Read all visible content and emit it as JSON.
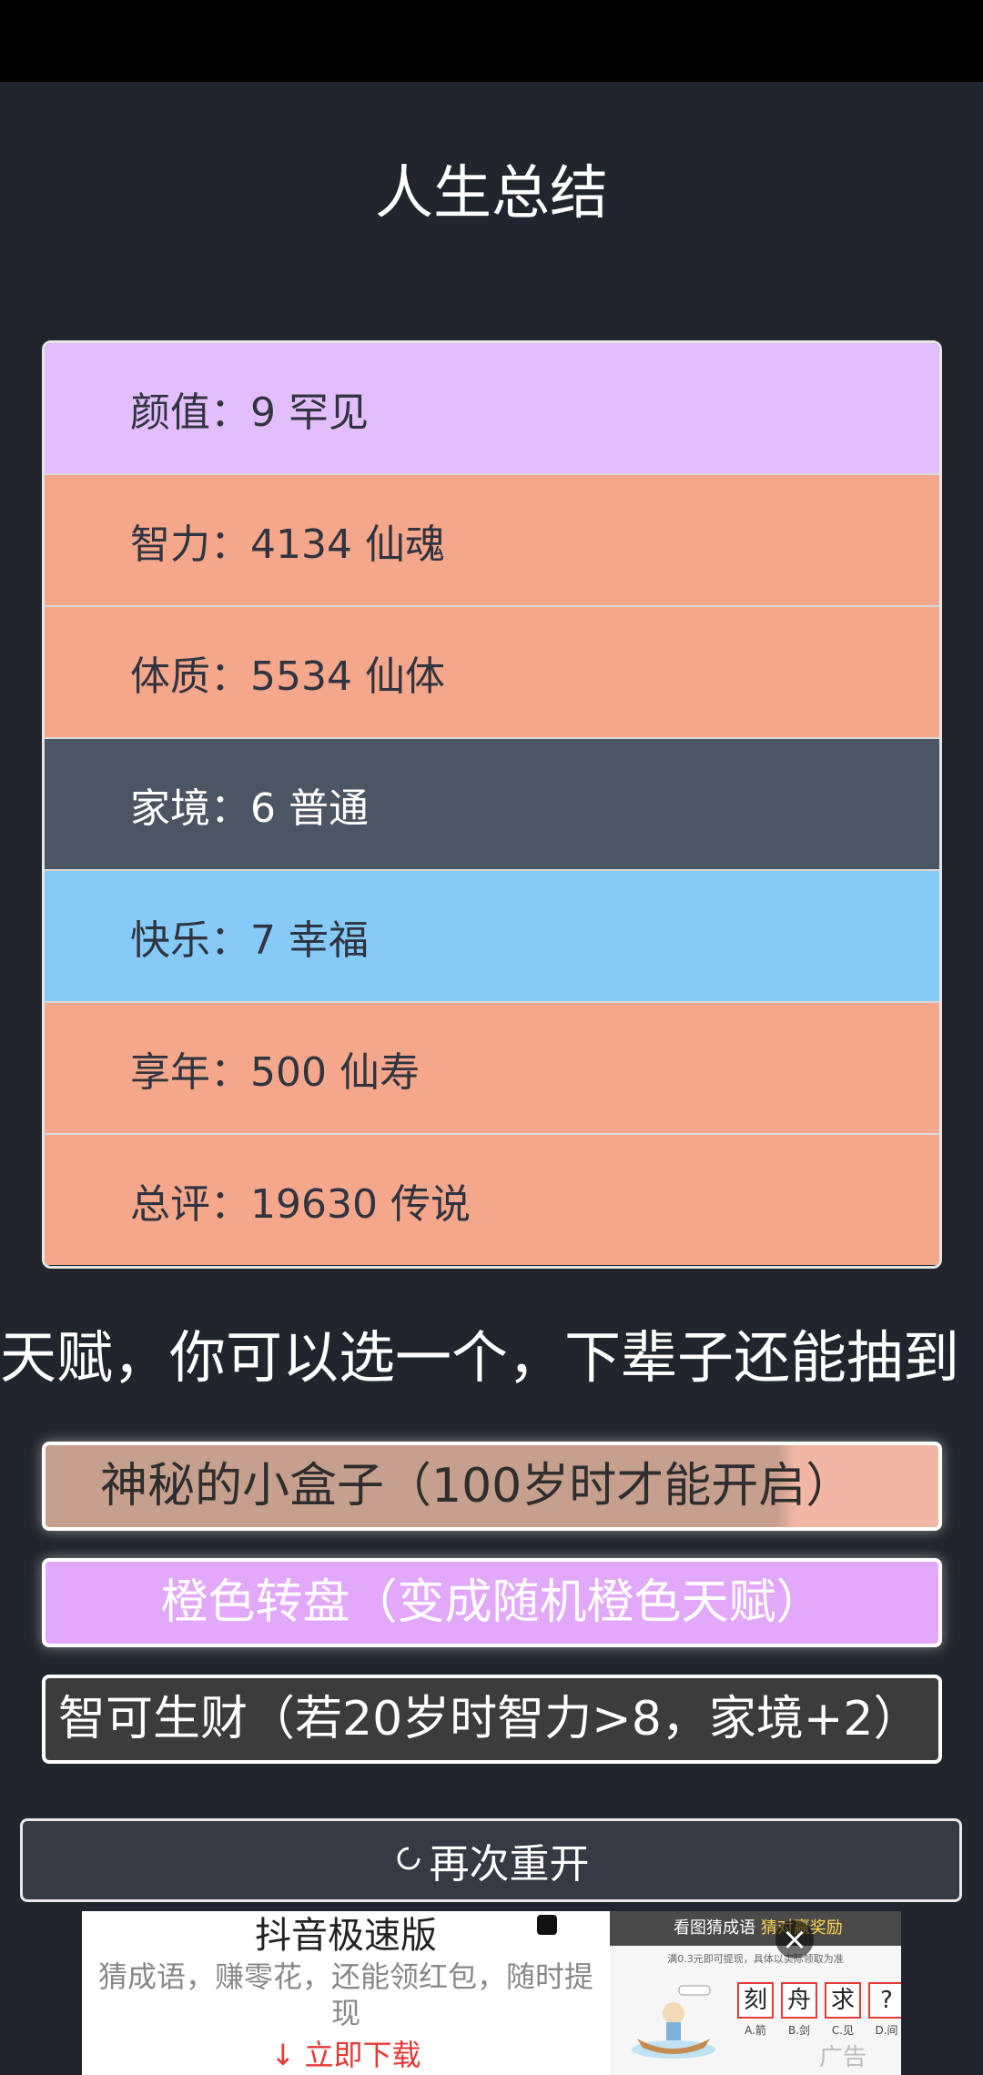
{
  "title": "人生总结",
  "stats": [
    {
      "text": "颜值：9 罕见",
      "color": "#e2befc"
    },
    {
      "text": "智力：4134 仙魂",
      "color": "#f4a78a"
    },
    {
      "text": "体质：5534 仙体",
      "color": "#f4a78a"
    },
    {
      "text": "家境：6 普通",
      "color": "#4c5563"
    },
    {
      "text": "快乐：7 幸福",
      "color": "#86cbf7"
    },
    {
      "text": "享年：500 仙寿",
      "color": "#f4a78a"
    },
    {
      "text": "总评：19630 传说",
      "color": "#f4a78a"
    }
  ],
  "talent_heading": "天赋，你可以选一个，下辈子还能抽到",
  "talents": [
    "神秘的小盒子（100岁时才能开启）",
    "橙色转盘（变成随机橙色天赋）",
    "智可生财（若20岁时智力>8，家境+2）"
  ],
  "restart_label": "再次重开",
  "ad": {
    "app_name": "抖音极速版",
    "description": "猜成语，赚零花，还能领红包，随时提现",
    "download_label": "↓ 立即下载",
    "banner_text": "看图猜成语",
    "banner_highlight": "猜对赢奖励",
    "sub_text": "满0.3元即可提现，具体以实际领取为准",
    "tiles": [
      "刻",
      "舟",
      "求",
      "?"
    ],
    "options": [
      "A.箭",
      "B.剑",
      "C.见",
      "D.间"
    ],
    "tag": "广告"
  }
}
